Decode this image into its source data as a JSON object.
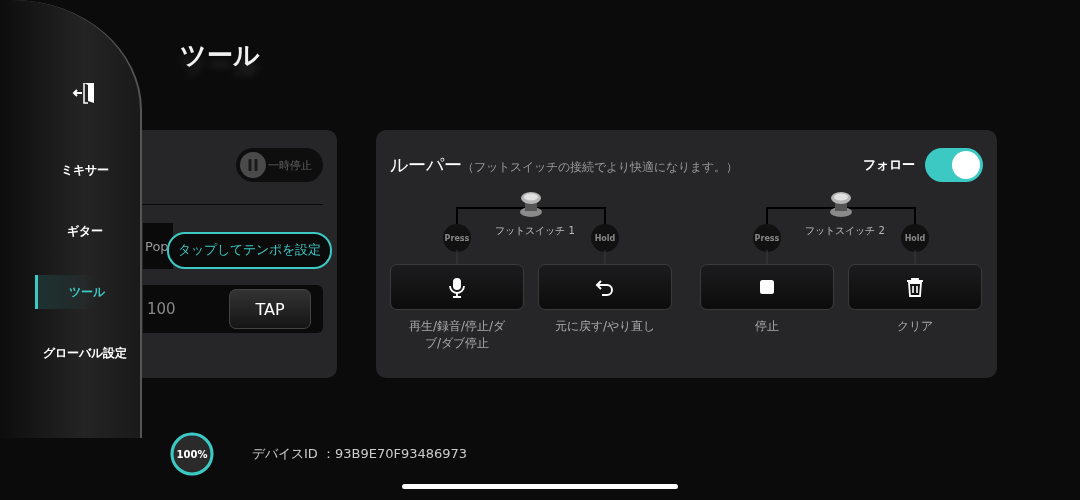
{
  "sidebar": {
    "items": [
      {
        "label": "ミキサー",
        "selected": false
      },
      {
        "label": "ギター",
        "selected": false
      },
      {
        "label": "ツール",
        "selected": true
      },
      {
        "label": "グローバル設定",
        "selected": false
      }
    ]
  },
  "title": "ツール",
  "tempo_panel": {
    "pause_button": "一時停止",
    "style_field": "Pop",
    "tooltip": "タップしてテンポを設定",
    "tempo_value": "100",
    "tap_button": "TAP"
  },
  "looper": {
    "title": "ルーパー",
    "note": "（フットスイッチの接続でより快適になります。）",
    "follow_label": "フォロー",
    "follow_on": true,
    "footswitches": [
      {
        "label": "フットスイッチ 1",
        "press": "Press",
        "hold": "Hold",
        "actions": [
          {
            "kind": "mic",
            "label": "再生/録音/停止/ダブ/ダブ停止"
          },
          {
            "kind": "undo",
            "label": "元に戻す/やり直し"
          }
        ]
      },
      {
        "label": "フットスイッチ 2",
        "press": "Press",
        "hold": "Hold",
        "actions": [
          {
            "kind": "stop",
            "label": "停止"
          },
          {
            "kind": "trash",
            "label": "クリア"
          }
        ]
      }
    ]
  },
  "status": {
    "battery": "100%",
    "level": 1,
    "device_id": "デバイスID ：93B9E70F93486973"
  }
}
